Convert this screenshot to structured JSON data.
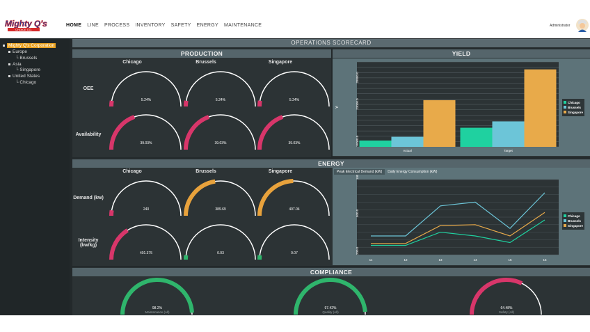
{
  "header": {
    "logo_text": "Mighty Q's",
    "logo_sub": "CHOICE CO.",
    "nav": [
      "HOME",
      "LINE",
      "PROCESS",
      "INVENTORY",
      "SAFETY",
      "ENERGY",
      "MAINTENANCE"
    ],
    "user": "Administrator"
  },
  "tree": {
    "root": "Mighty Q's Corporation",
    "items": [
      {
        "label": "Europe",
        "level": 1
      },
      {
        "label": "Brussels",
        "level": 2
      },
      {
        "label": "Asia",
        "level": 1
      },
      {
        "label": "Singapore",
        "level": 2
      },
      {
        "label": "United States",
        "level": 1
      },
      {
        "label": "Chicago",
        "level": 2
      }
    ]
  },
  "scorecard_title": "OPERATIONS SCORECARD",
  "production": {
    "title": "PRODUCTION",
    "columns": [
      "Chicago",
      "Brussels",
      "Singapore"
    ],
    "rows": [
      {
        "label": "OEE",
        "gauges": [
          {
            "value": "5.24%",
            "fraction": 0.0524,
            "color": "#d8366a"
          },
          {
            "value": "5.24%",
            "fraction": 0.0524,
            "color": "#d8366a"
          },
          {
            "value": "5.24%",
            "fraction": 0.0524,
            "color": "#d8366a"
          }
        ]
      },
      {
        "label": "Availability",
        "gauges": [
          {
            "value": "39.03%",
            "fraction": 0.3903,
            "color": "#d8366a"
          },
          {
            "value": "39.03%",
            "fraction": 0.3903,
            "color": "#d8366a"
          },
          {
            "value": "39.03%",
            "fraction": 0.3903,
            "color": "#d8366a"
          }
        ]
      }
    ]
  },
  "yield": {
    "title": "YIELD",
    "ylabel": "Yi",
    "yticks": [
      "28000.0",
      "23000.0",
      "16000.0"
    ],
    "categories": [
      "Actual",
      "Target"
    ],
    "legend": [
      {
        "name": "Chicago",
        "color": "#1fd1a0"
      },
      {
        "name": "Brussels",
        "color": "#6cc5d8"
      },
      {
        "name": "Singapore",
        "color": "#e8aa4a"
      }
    ]
  },
  "energy": {
    "title": "ENERGY",
    "columns": [
      "Chicago",
      "Brussels",
      "Singapore"
    ],
    "rows": [
      {
        "label": "Demand (kw)",
        "gauges": [
          {
            "value": "240",
            "fraction": 0.05,
            "color": "#d8366a"
          },
          {
            "value": "389.69",
            "fraction": 0.45,
            "color": "#e8a23c"
          },
          {
            "value": "407.04",
            "fraction": 0.49,
            "color": "#e8a23c"
          }
        ]
      },
      {
        "label": "Intensity (kw/kg)",
        "gauges": [
          {
            "value": "401.375",
            "fraction": 0.32,
            "color": "#d8366a"
          },
          {
            "value": "0.03",
            "fraction": 0.0,
            "color": "#2fb56c"
          },
          {
            "value": "0.07",
            "fraction": 0.0,
            "color": "#2fb56c"
          }
        ]
      }
    ],
    "tabs": [
      "Peak Electrical Demand (kW)",
      "Daily Energy Consumption (kW)"
    ],
    "yticks": [
      "1000.0",
      "500.0",
      "200.0"
    ],
    "xticks": [
      "11",
      "12",
      "13",
      "14",
      "15",
      "16"
    ],
    "legend": [
      {
        "name": "Chicago",
        "color": "#1fd1a0"
      },
      {
        "name": "Brussels",
        "color": "#6cc5d8"
      },
      {
        "name": "Singapore",
        "color": "#e8aa4a"
      }
    ]
  },
  "compliance": {
    "title": "COMPLIANCE",
    "gauges": [
      {
        "value": "98.2%",
        "label": "Maintenance (All)",
        "fraction": 0.982,
        "color": "#2fb56c"
      },
      {
        "value": "97.42%",
        "label": "Quality (All)",
        "fraction": 0.9742,
        "color": "#2fb56c"
      },
      {
        "value": "64.48%",
        "label": "Safety (All)",
        "fraction": 0.6448,
        "color": "#d8366a"
      }
    ]
  },
  "chart_data": [
    {
      "type": "bar",
      "title": "YIELD",
      "categories": [
        "Actual",
        "Target"
      ],
      "series": [
        {
          "name": "Chicago",
          "values": [
            17200,
            19600
          ]
        },
        {
          "name": "Brussels",
          "values": [
            17900,
            20800
          ]
        },
        {
          "name": "Singapore",
          "values": [
            24800,
            30600
          ]
        }
      ],
      "ylim": [
        16000,
        32000
      ]
    },
    {
      "type": "line",
      "x": [
        11,
        12,
        13,
        14,
        15,
        16
      ],
      "series": [
        {
          "name": "Chicago",
          "values": [
            300,
            300,
            440,
            400,
            330,
            570
          ]
        },
        {
          "name": "Brussels",
          "values": [
            400,
            400,
            720,
            760,
            480,
            860
          ]
        },
        {
          "name": "Singapore",
          "values": [
            320,
            320,
            510,
            520,
            400,
            650
          ]
        }
      ]
    }
  ]
}
